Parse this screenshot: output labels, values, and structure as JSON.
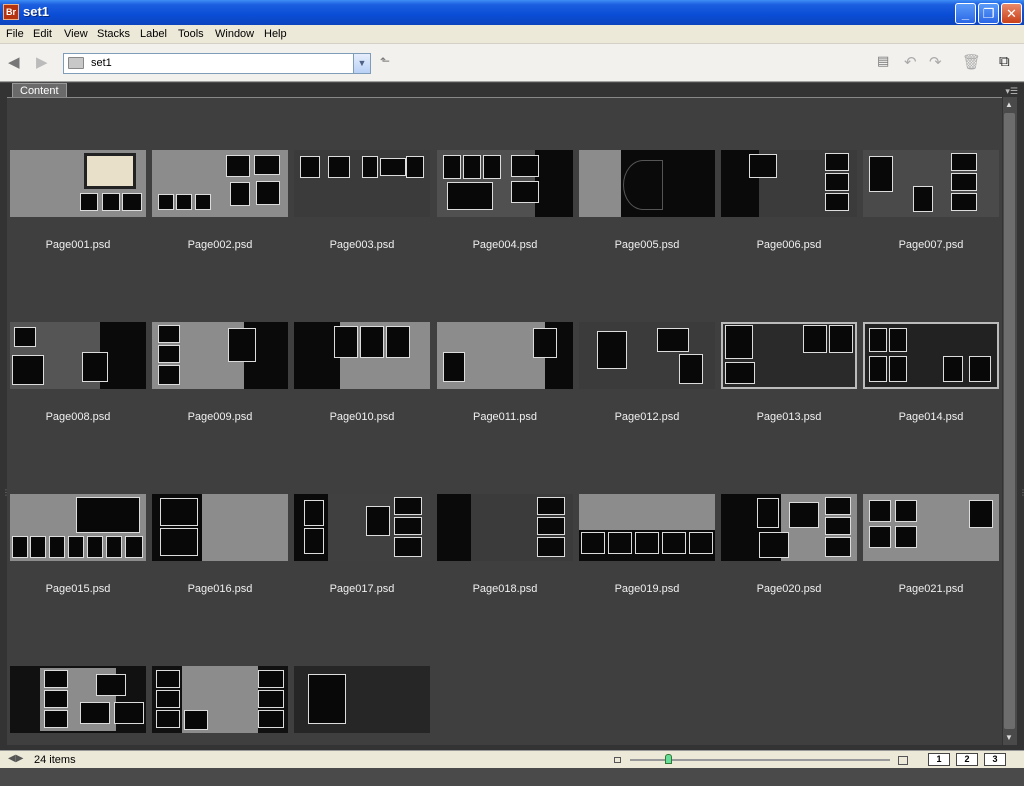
{
  "window": {
    "app_icon_text": "Br",
    "title": "set1"
  },
  "menu": [
    "File",
    "Edit",
    "View",
    "Stacks",
    "Label",
    "Tools",
    "Window",
    "Help"
  ],
  "path": {
    "folder": "set1"
  },
  "panel": {
    "tab": "Content"
  },
  "files": [
    "Page001.psd",
    "Page002.psd",
    "Page003.psd",
    "Page004.psd",
    "Page005.psd",
    "Page006.psd",
    "Page007.psd",
    "Page008.psd",
    "Page009.psd",
    "Page010.psd",
    "Page011.psd",
    "Page012.psd",
    "Page013.psd",
    "Page014.psd",
    "Page015.psd",
    "Page016.psd",
    "Page017.psd",
    "Page018.psd",
    "Page019.psd",
    "Page020.psd",
    "Page021.psd",
    "",
    "",
    ""
  ],
  "status": {
    "count": "24 items",
    "view_buttons": [
      "1",
      "2",
      "3"
    ]
  }
}
